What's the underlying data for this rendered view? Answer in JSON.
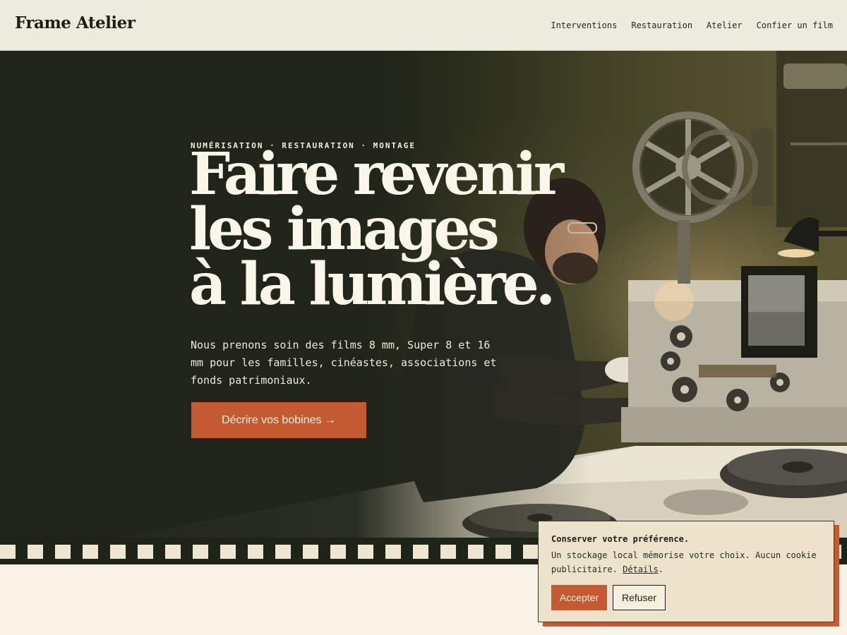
{
  "brand": {
    "logo": "Frame Atelier"
  },
  "nav": [
    {
      "label": "Interventions"
    },
    {
      "label": "Restauration"
    },
    {
      "label": "Atelier"
    },
    {
      "label": "Confier un film"
    }
  ],
  "hero": {
    "eyebrow": "NUMÉRISATION · RESTAURATION · MONTAGE",
    "headline": [
      "Faire revenir",
      "les images",
      "à la lumière."
    ],
    "lead": "Nous prenons soin des films 8 mm, Super 8 et 16 mm pour les familles, cinéastes, associations et fonds patrimoniaux.",
    "cta": "Décrire vos bobines →"
  },
  "cookie": {
    "title": "Conserver votre préférence.",
    "text": "Un stockage local mémorise votre choix. Aucun cookie publicitaire.",
    "link": "Détails",
    "after_link": ".",
    "accept": "Accepter",
    "refuse": "Refuser"
  },
  "colors": {
    "accent": "#c45a32",
    "hero_dark": "#20241a",
    "header_bg": "#edeade",
    "cream": "#faf4e8"
  }
}
